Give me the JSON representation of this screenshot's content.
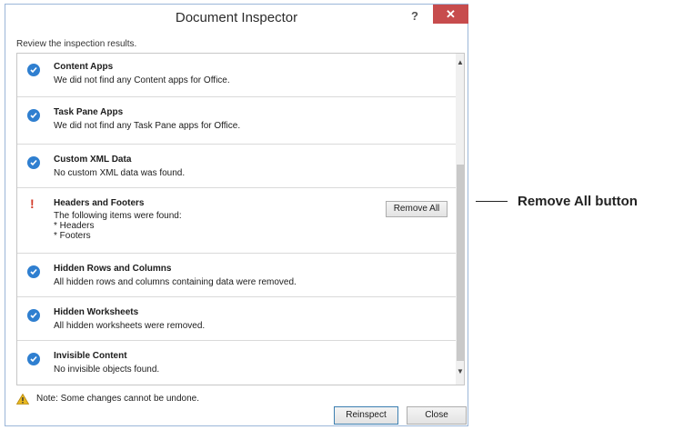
{
  "window": {
    "title": "Document Inspector",
    "help": "?",
    "close_glyph": "✕"
  },
  "subtitle": "Review the inspection results.",
  "results": [
    {
      "status": "ok",
      "title": "Content Apps",
      "lines": [
        "We did not find any Content apps for Office."
      ]
    },
    {
      "status": "ok",
      "title": "Task Pane Apps",
      "lines": [
        "We did not find any Task Pane apps for Office."
      ]
    },
    {
      "status": "ok",
      "title": "Custom XML Data",
      "lines": [
        "No custom XML data was found."
      ]
    },
    {
      "status": "warning",
      "title": "Headers and Footers",
      "lines": [
        "The following items were found:",
        "* Headers",
        "* Footers"
      ],
      "action": "Remove All"
    },
    {
      "status": "ok",
      "title": "Hidden Rows and Columns",
      "lines": [
        "All hidden rows and columns containing data were removed."
      ]
    },
    {
      "status": "ok",
      "title": "Hidden Worksheets",
      "lines": [
        "All hidden worksheets were removed."
      ]
    },
    {
      "status": "ok",
      "title": "Invisible Content",
      "lines": [
        "No invisible objects found."
      ]
    }
  ],
  "note": "Note: Some changes cannot be undone.",
  "buttons": {
    "reinspect": "Reinspect",
    "close": "Close"
  },
  "callout": "Remove All button",
  "colors": {
    "check": "#2f7fd0",
    "warning": "#d33b2a",
    "close_button": "#c74c4d",
    "warning_triangle": "#e8b820"
  }
}
